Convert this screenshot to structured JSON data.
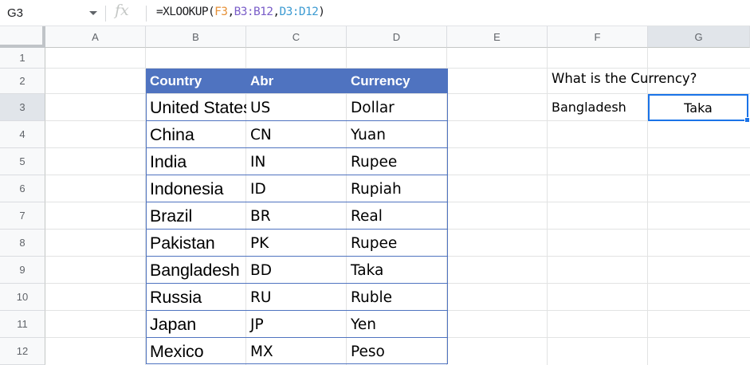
{
  "formula_bar": {
    "cell_ref": "G3",
    "fx_symbol": "fx",
    "formula_prefix": "=XLOOKUP(",
    "ref1": "F3",
    "comma1": ",",
    "ref2": "B3:B12",
    "comma2": ",",
    "ref3": "D3:D12",
    "formula_suffix": ")"
  },
  "columns": [
    "A",
    "B",
    "C",
    "D",
    "E",
    "F",
    "G"
  ],
  "rows": [
    "1",
    "2",
    "3",
    "4",
    "5",
    "6",
    "7",
    "8",
    "9",
    "10",
    "11",
    "12"
  ],
  "table": {
    "headers": [
      "Country",
      "Abr",
      "Currency"
    ],
    "rows": [
      {
        "country": "United States",
        "abr": "US",
        "currency": "Dollar"
      },
      {
        "country": "China",
        "abr": "CN",
        "currency": "Yuan"
      },
      {
        "country": "India",
        "abr": "IN",
        "currency": "Rupee"
      },
      {
        "country": "Indonesia",
        "abr": "ID",
        "currency": "Rupiah"
      },
      {
        "country": "Brazil",
        "abr": "BR",
        "currency": "Real"
      },
      {
        "country": "Pakistan",
        "abr": "PK",
        "currency": "Rupee"
      },
      {
        "country": "Bangladesh",
        "abr": "BD",
        "currency": "Taka"
      },
      {
        "country": "Russia",
        "abr": "RU",
        "currency": "Ruble"
      },
      {
        "country": "Japan",
        "abr": "JP",
        "currency": "Yen"
      },
      {
        "country": "Mexico",
        "abr": "MX",
        "currency": "Peso"
      }
    ]
  },
  "lookup": {
    "question": "What is the Currency?",
    "input_value": "Bangladesh",
    "result_value": "Taka"
  },
  "colors": {
    "table_header_bg": "#4f73c0",
    "selection": "#1a73e8",
    "ref1": "#e69138",
    "ref2": "#7a5ec8",
    "ref3": "#3d9bd2"
  },
  "icons": {
    "name_box_dropdown": "chevron-down-icon",
    "function": "fx-icon"
  }
}
